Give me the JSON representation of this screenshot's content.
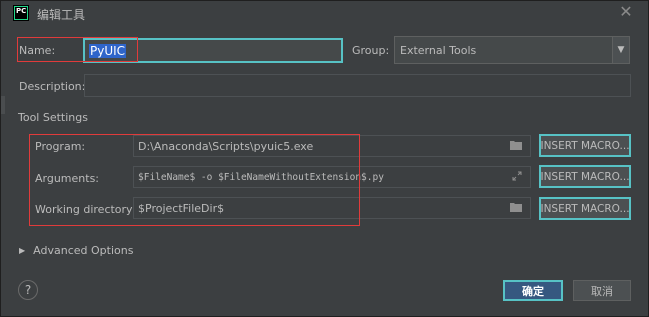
{
  "window": {
    "title": "编辑工具",
    "app_icon_text": "PC",
    "close_glyph": "✕"
  },
  "form": {
    "name_label": "Name:",
    "name_value": "PyUIC",
    "group_label": "Group:",
    "group_value": "External Tools",
    "description_label": "Description:",
    "description_value": "",
    "tool_settings_label": "Tool Settings",
    "program_label": "Program:",
    "program_value": "D:\\Anaconda\\Scripts\\pyuic5.exe",
    "arguments_label": "Arguments:",
    "arguments_value": "$FileName$ -o $FileNameWithoutExtension$.py",
    "workdir_label": "Working directory:",
    "workdir_value": "$ProjectFileDir$",
    "insert_macro_label": "INSERT MACRO...",
    "advanced_label": "Advanced Options"
  },
  "buttons": {
    "help": "?",
    "ok": "确定",
    "cancel": "取消"
  },
  "icons": {
    "folder": "folder-icon",
    "expand": "expand-icon",
    "dropdown": "chevron-down-icon",
    "triangle": "triangle-right-icon"
  },
  "colors": {
    "background": "#3c3f41",
    "field": "#45494a",
    "focus_border": "#57c2c5",
    "highlight_box": "#e03b3b",
    "selection": "#2f65ca",
    "ok_button": "#365880"
  }
}
